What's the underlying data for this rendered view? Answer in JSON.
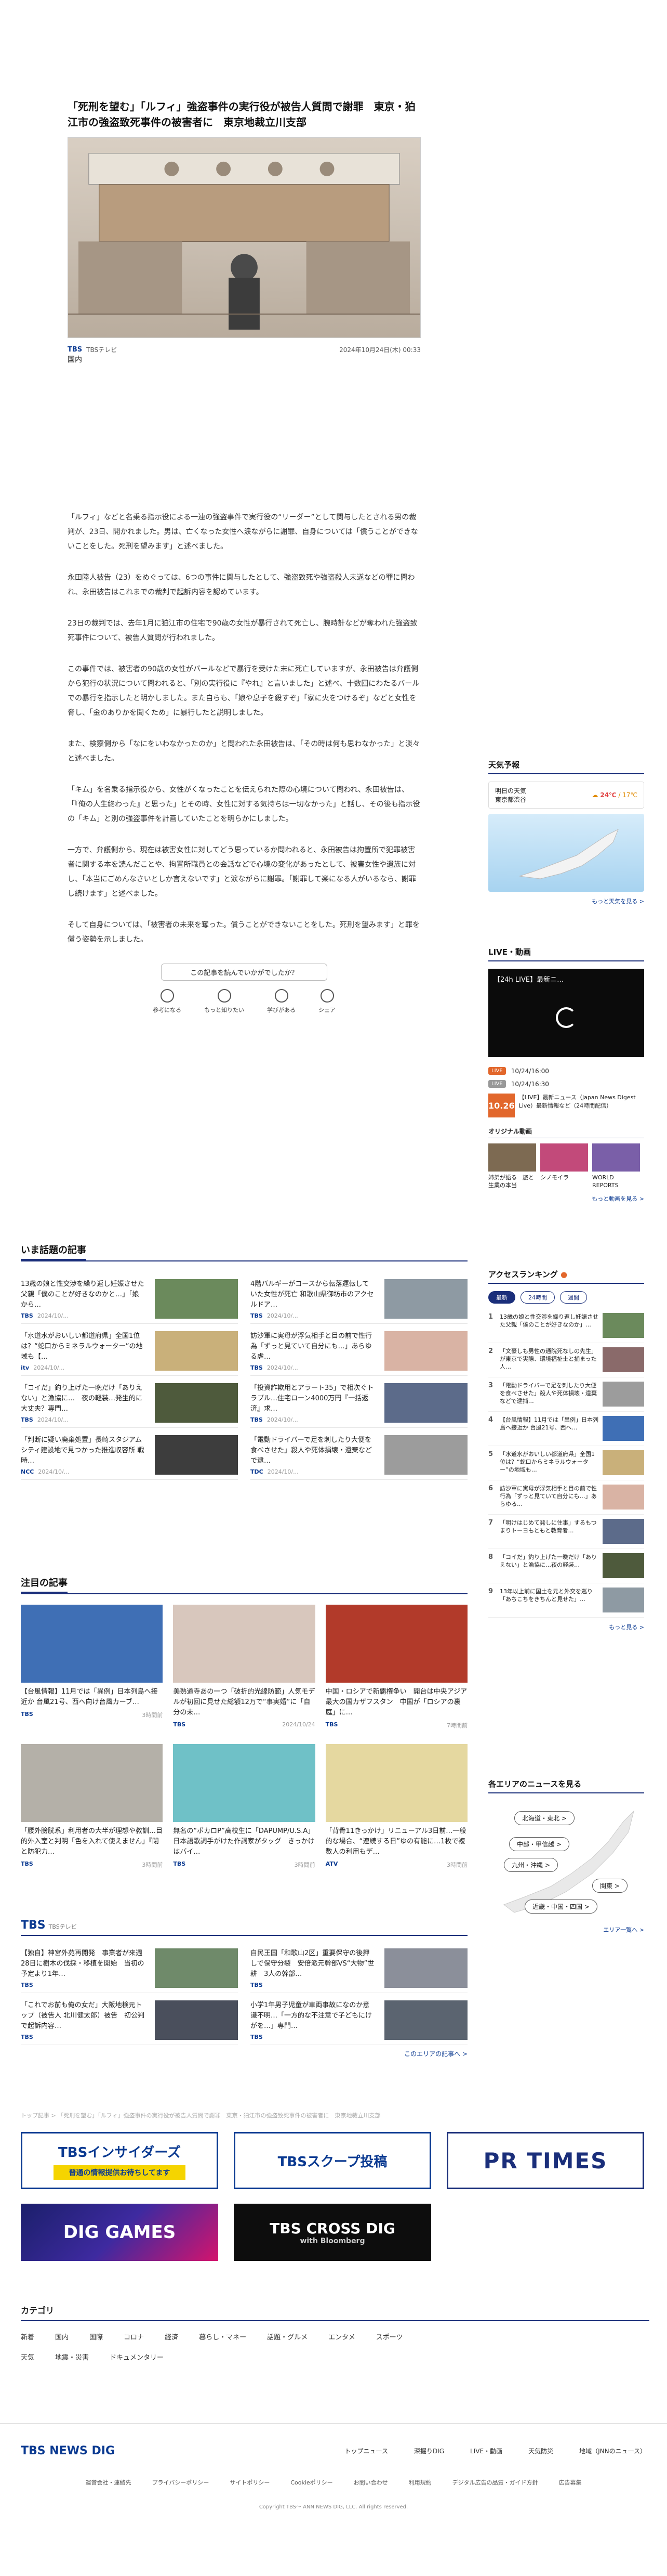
{
  "article": {
    "headline": "「死刑を望む」「ルフィ」強盗事件の実行役が被告人質問で謝罪　東京・狛江市の強盗致死事件の被害者に　東京地裁立川支部",
    "source": "TBS",
    "source_name": "TBSテレビ",
    "date": "2024年10月24日(木) 00:33",
    "tag": "国内",
    "paragraphs": [
      "「ルフィ」などと名乗る指示役による一連の強盗事件で実行役の“リーダー”として関与したとされる男の裁判が、23日、開かれました。男は、亡くなった女性へ涙ながらに謝罪、自身については「償うことができないことをした。死刑を望みます」と述べました。",
      "永田陸人被告（23）をめぐっては、6つの事件に関与したとして、強盗致死や強盗殺人未遂などの罪に問われ、永田被告はこれまでの裁判で起訴内容を認めています。",
      "23日の裁判では、去年1月に狛江市の住宅で90歳の女性が暴行されて死亡し、腕時計などが奪われた強盗致死事件について、被告人質問が行われました。",
      "この事件では、被害者の90歳の女性がバールなどで暴行を受けた末に死亡していますが、永田被告は弁護側から犯行の状況について問われると、「別の実行役に『やれ』と言いました」と述べ、十数回にわたるバールでの暴行を指示したと明かしました。また自らも、「娘や息子を殺すぞ」「家に火をつけるぞ」などと女性を脅し、「金のありかを聞くため」に暴行したと説明しました。",
      "また、検察側から「なにをいわなかったのか」と問われた永田被告は、「その時は何も思わなかった」と淡々と述べました。",
      "「キム」を名乗る指示役から、女性がくなったことを伝えられた際の心境について問われ、永田被告は、「『俺の人生終わった』と思った」とその時、女性に対する気持ちは一切なかった」と話し、その後も指示役の「キム」と別の強盗事件を計画していたことを明らかにしました。",
      "一方で、弁護側から、現在は被害女性に対してどう思っているか問われると、永田被告は拘置所で犯罪被害者に関する本を読んだことや、拘置所職員との会話などで心境の変化があったとして、被害女性や遺族に対し、「本当にごめんなさいとしか言えないです」と涙ながらに謝罪。「謝罪して楽になる人がいるなら、謝罪し続けます」と述べました。",
      "そして自身については、「被害者の未来を奪った。償うことができないことをした。死刑を望みます」と罪を償う姿勢を示しました。"
    ],
    "feedback_prompt": "この記事を読んでいかがでしたか？",
    "reactions": [
      "参考になる",
      "もっと知りたい",
      "学びがある",
      "シェア"
    ]
  },
  "wadai": {
    "title": "いま話題の記事",
    "items": [
      {
        "text": "13歳の娘と性交渉を繰り返し妊娠させた父親「僕のことが好きなのかと…」「娘から…",
        "source": "TBS",
        "date": "2024/10/..."
      },
      {
        "text": "4階バルギーがコースから転落運転していた女性が死亡 和歌山県御坊市のアクセルドア…",
        "source": "TBS",
        "date": "2024/10/..."
      },
      {
        "text": "「水道水がおいしい都道府県」全国1位は？“蛇口からミネラルウォーター”の地域も【…",
        "source": "itv",
        "date": "2024/10/..."
      },
      {
        "text": "訪沙軍に実母が浮気相手と目の前で性行為「ずっと見ていて自分にも…」あらゆる虐…",
        "source": "TBS",
        "date": "2024/10/..."
      },
      {
        "text": "「コイだ」釣り上げた一晩だけ「ありえない」と漁協に…　夜の軽装…発生的に大丈夫？専門…",
        "source": "TBS",
        "date": "2024/10/..."
      },
      {
        "text": "「投資詐欺用とアラート35」で相次ぐトラブル…住宅ローン4000万円『一括返済』求…",
        "source": "TBS",
        "date": "2024/10/..."
      },
      {
        "text": "「判断に疑い廃棄処置」長崎スタジアムシティ建設地で見つかった推進収容所 戦時…",
        "source": "NCC",
        "date": "2024/10/..."
      },
      {
        "text": "「電動ドライバーで足を刺したり大便を食べさせた」殺人や死体損壊・遺棄などで逮…",
        "source": "TDC",
        "date": "2024/10/..."
      }
    ]
  },
  "chumoku": {
    "title": "注目の記事",
    "items": [
      {
        "text": "【台風情報】11月では「異例」日本列島へ接近か 台風21号、西へ向け台風カーブ…",
        "source": "TBS",
        "date": "3時間前"
      },
      {
        "text": "美熟道寺あの一つ「破折的光線防範」人気モデルが初回に見せた総額12万で“事実婚”に「自分の未…",
        "source": "TBS",
        "date": "2024/10/24"
      },
      {
        "text": "中国・ロシアで新覇権争い　開台は中央アジア最大の国カザフスタン　中国が「ロシアの裏庭」に…",
        "source": "TBS",
        "date": "7時間前"
      },
      {
        "text": "「腰外膀胱系」利用者の大半が理想や教訓…目的外入室と判明「色を入れて使えません」『閉と防犯力…",
        "source": "TBS",
        "date": "3時間前"
      },
      {
        "text": "無名の“ポカロP”高校生に「DAPUMP/U.S.A」日本語歌詞手がけた作詞家がタッグ　きっかけはバイ…",
        "source": "TBS",
        "date": "3時間前"
      },
      {
        "text": "「背骨11きっかけ」リニューアル3日前…一般的な場合、“連続する日”ゆの有能に…1枚で複数人の利用もデ…",
        "source": "ATV",
        "date": "3時間前"
      }
    ]
  },
  "tbs": {
    "title": "TBS",
    "subtitle": "TBSテレビ",
    "items": [
      {
        "text": "【独自】神宮外苑再開発　事業者が来週28日に樹木の伐採・移植を開始　当初の予定より1年…",
        "source": "TBS",
        "date": ""
      },
      {
        "text": "自民王国「和歌山2区」重要保守の後押しで保守分裂　安倍派元幹部VS“大物”世耕　3人の幹部…",
        "source": "TBS",
        "date": ""
      },
      {
        "text": "「これでお前も俺の女だ」大阪地検元トップ（被告人 北川健太郎）被告　初公判で起訴内容…",
        "source": "TBS",
        "date": ""
      },
      {
        "text": "小学1年男子児童が車両事故になのか意識不明…「一方的な不注意で子どもにけがを…」専門…",
        "source": "TBS",
        "date": ""
      }
    ],
    "more": "このエリアの記事へ >"
  },
  "breadcrumb": "トップ記事 > 「死刑を望む」「ルフィ」強盗事件の実行役が被告人質問で謝罪　東京・狛江市の強盗致死事件の被害者に　東京地裁立川支部",
  "banners": {
    "insiders": "TBSインサイダーズ",
    "insiders_strip": "普通の情報提供お待ちしてます",
    "scoop": "TBSスクープ投稿",
    "prtimes": "PR TIMES",
    "diggames": "DIG GAMES",
    "crossdig": "TBS CROSS DIG",
    "crossdig_sub": "with Bloomberg"
  },
  "categories": {
    "title": "カテゴリ",
    "items": [
      "新着",
      "国内",
      "国際",
      "コロナ",
      "経済",
      "暮らし・マネー",
      "話題・グルメ",
      "エンタメ",
      "スポーツ",
      "天気",
      "地震・災害",
      "ドキュメンタリー"
    ]
  },
  "footer": {
    "logo": "TBS NEWS DIG",
    "nav": [
      "トップニュース",
      "深掘りDIG",
      "LIVE・動画",
      "天気防災",
      "地域（JNNのニュース）"
    ],
    "links": [
      "運営会社・連絡先",
      "プライバシーポリシー",
      "サイトポリシー",
      "Cookieポリシー",
      "お問い合わせ",
      "利用規約",
      "デジタル広告の品質・ガイド方針",
      "広告募集"
    ],
    "copyright": "Copyright TBS～ ANN NEWS DIG, LLC. All rights reserved."
  },
  "sidebar": {
    "weather_title": "天気予報",
    "weather_label": "明日の天気",
    "weather_city": "東京都渋谷",
    "weather_temp_hi": "24℃",
    "weather_temp_lo": "17℃",
    "weather_more": "もっと天気を見る >",
    "live_title": "LIVE・動画",
    "live_player_title": "【24h LIVE】最新ニ…",
    "live_schedule": [
      {
        "tag": "LIVE",
        "time": "10/24/16:00",
        "text": ""
      },
      {
        "tag": "LIVE",
        "time": "10/24/16:30",
        "text": ""
      }
    ],
    "now_time": "10.26",
    "now_text": "【LIVE】最新ニュース（Japan News Digest Live）最新情報など（24時間配信）",
    "orig_title": "オリジナル動画",
    "orig_items": [
      "姉弟が語る　旅と生業の本当",
      "シノモイラ",
      "WORLD REPORTS"
    ],
    "video_more": "もっと動画を見る >",
    "access_title": "アクセスランキング",
    "access_tabs": [
      "最新",
      "24時間",
      "週間"
    ],
    "ranking": [
      "13歳の娘と性交渉を繰り返し妊娠させた父親「僕のことが好きなのか」…",
      "「文豪しも男性の通院死なしの先生」が東京で実際、環境福祉士と捕まった人…",
      "「電動ドライバーで足を刺したり大便を食べさせた」殺人や死体損壊・遺棄などで逮捕…",
      "【台風情報】11月では「異例」日本列島へ接近か 台風21号、西へ…",
      "「水道水がおいしい都道府県」全国1位は？“蛇口からミネラルウォーター”の地域も…",
      "訪沙軍に実母が浮気相手と目の前で性行為「ずっと見ていて自分にも…」あらゆる…",
      "「明けはじめて発しに住事」するもつまりトーヨもともと教育者…",
      "「コイだ」釣り上げた一晩だけ「ありえない」と漁協に…夜の軽装…",
      "13年以上前に国土を元と外交を巡り「あちこちをきちんと見せた」…"
    ],
    "ranking_more": "もっと見る >",
    "area_title": "各エリアのニュースを見る",
    "areas": [
      "北海道・東北 >",
      "中部・甲信越 >",
      "九州・沖縄 >",
      "関東 >",
      "近畿・中国・四国 >"
    ],
    "area_more": "エリア一覧へ >"
  }
}
